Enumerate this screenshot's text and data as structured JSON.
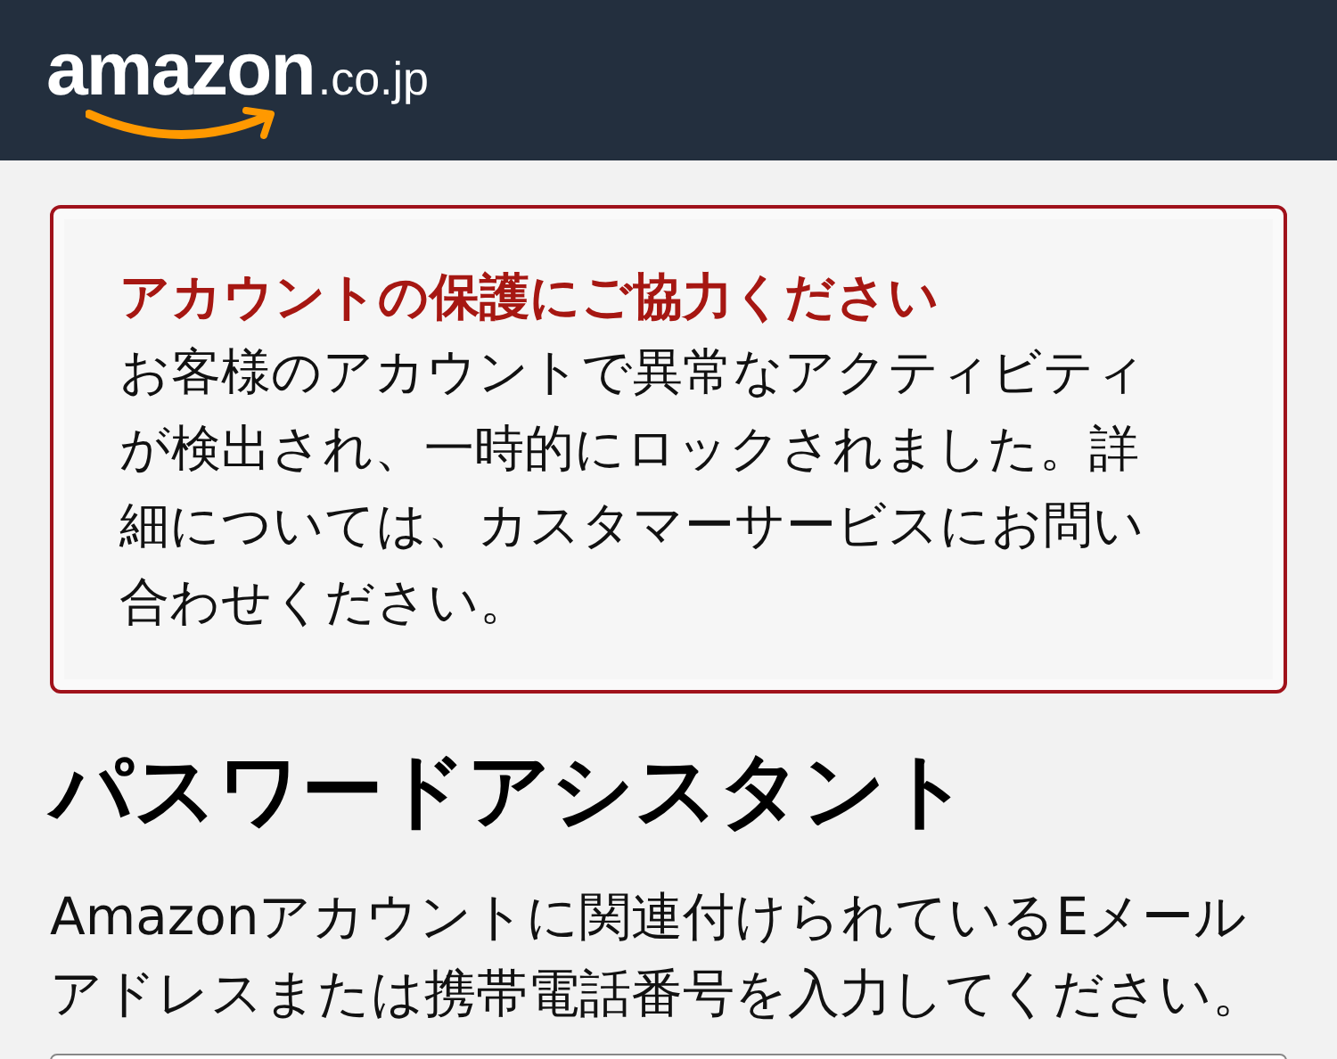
{
  "header": {
    "logo": {
      "wordmark": "amazon",
      "domain": ".co.jp"
    }
  },
  "alert": {
    "title": "アカウントの保護にご協力ください",
    "message": "お客様のアカウントで異常なアクティビティが検出され、一時的にロックされました。詳細については、カスタマーサービスにお問い合わせください。"
  },
  "heading": "パスワードアシスタント",
  "instructions": "Amazonアカウントに関連付けられているEメールアドレスまたは携帯電話番号を入力してください。"
}
